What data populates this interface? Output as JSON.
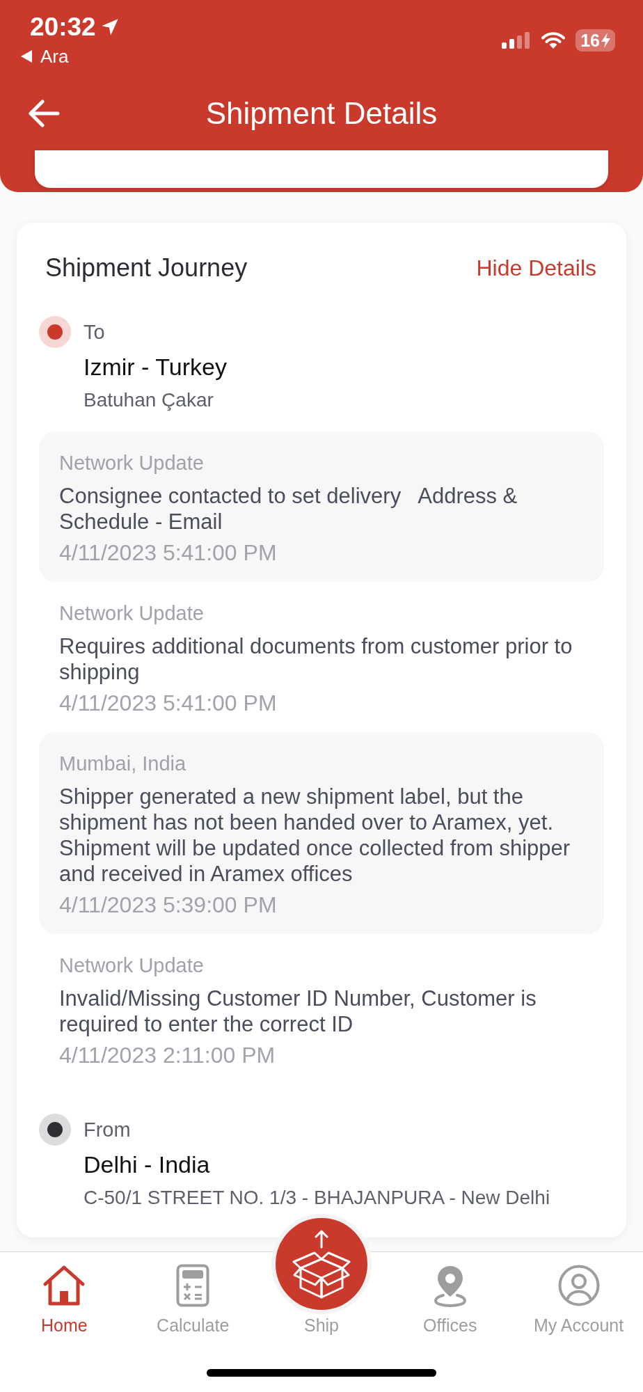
{
  "status_bar": {
    "time": "20:32",
    "back_app": "Ara",
    "battery": "16"
  },
  "header": {
    "title": "Shipment Details"
  },
  "journey": {
    "title": "Shipment Journey",
    "toggle": "Hide Details",
    "to": {
      "label": "To",
      "place": "Izmir - Turkey",
      "detail": "Batuhan Çakar"
    },
    "events": [
      {
        "location": "Network Update",
        "description": "Consignee contacted to set delivery   Address & Schedule - Email",
        "time": "4/11/2023 5:41:00 PM"
      },
      {
        "location": "Network Update",
        "description": "Requires additional documents from customer prior to shipping",
        "time": "4/11/2023 5:41:00 PM"
      },
      {
        "location": "Mumbai, India",
        "description": "Shipper generated a new shipment label, but the shipment has not been handed over to Aramex, yet. Shipment will be updated once collected from shipper and received in Aramex offices",
        "time": "4/11/2023 5:39:00 PM"
      },
      {
        "location": "Network Update",
        "description": "Invalid/Missing Customer ID Number, Customer is required to enter the correct ID",
        "time": "4/11/2023 2:11:00 PM"
      }
    ],
    "from": {
      "label": "From",
      "place": "Delhi - India",
      "detail": "C-50/1 STREET NO. 1/3 - BHAJANPURA - New Delhi"
    }
  },
  "nav": {
    "items": [
      {
        "kind": "tab",
        "label": "Home",
        "selected": true
      },
      {
        "kind": "tab",
        "label": "Calculate",
        "selected": false
      },
      {
        "kind": "action",
        "label": "Ship",
        "selected": false
      },
      {
        "kind": "tab",
        "label": "Offices",
        "selected": false
      },
      {
        "kind": "tab",
        "label": "My Account",
        "selected": false
      }
    ]
  }
}
